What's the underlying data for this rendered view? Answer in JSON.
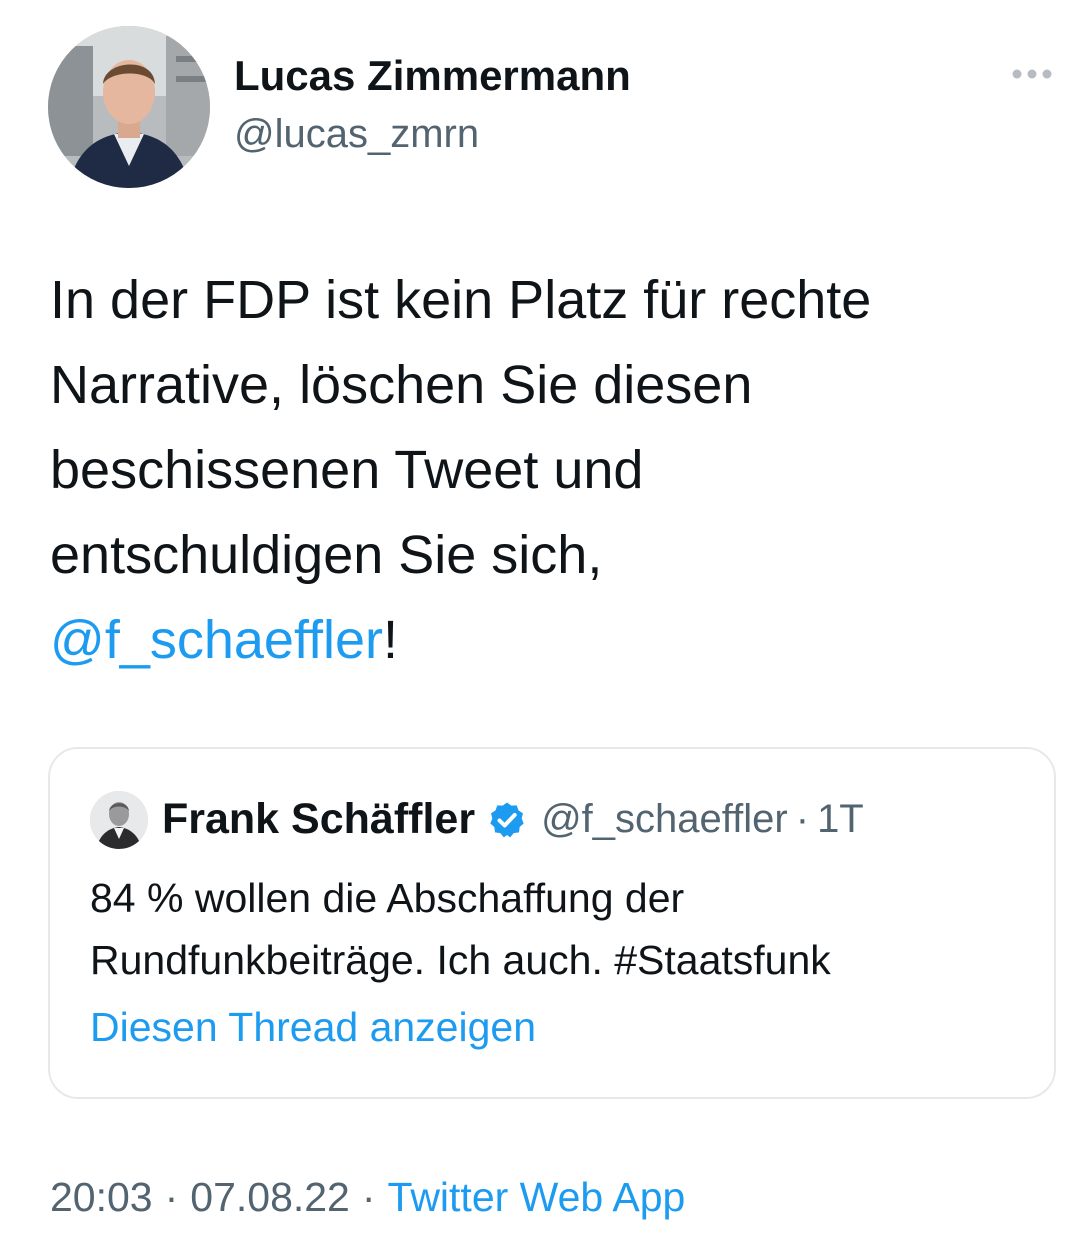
{
  "author": {
    "name": "Lucas Zimmermann",
    "handle": "@lucas_zmrn"
  },
  "tweet": {
    "lines": [
      "In der FDP ist kein Platz für rechte",
      "Narrative, löschen Sie diesen",
      "beschissenen Tweet und",
      "entschuldigen Sie sich,"
    ],
    "mention": "@f_schaeffler",
    "trailing": "!"
  },
  "quoted_tweet": {
    "name": "Frank Schäffler",
    "handle": "@f_schaeffler",
    "separator": "·",
    "time": "1T",
    "text_lines": [
      "84 % wollen die Abschaffung der",
      "Rundfunkbeiträge. Ich auch. #Staatsfunk"
    ],
    "show_thread": "Diesen Thread anzeigen"
  },
  "footer": {
    "time": "20:03",
    "date": "07.08.22",
    "separator": "·",
    "source": "Twitter Web App"
  },
  "icons": {
    "more": "more-horizontal-icon",
    "verified": "verified-badge-icon"
  },
  "colors": {
    "link": "#1d9bf0",
    "text": "#0f1419",
    "secondary": "#536471",
    "border": "#e6e9ec"
  }
}
